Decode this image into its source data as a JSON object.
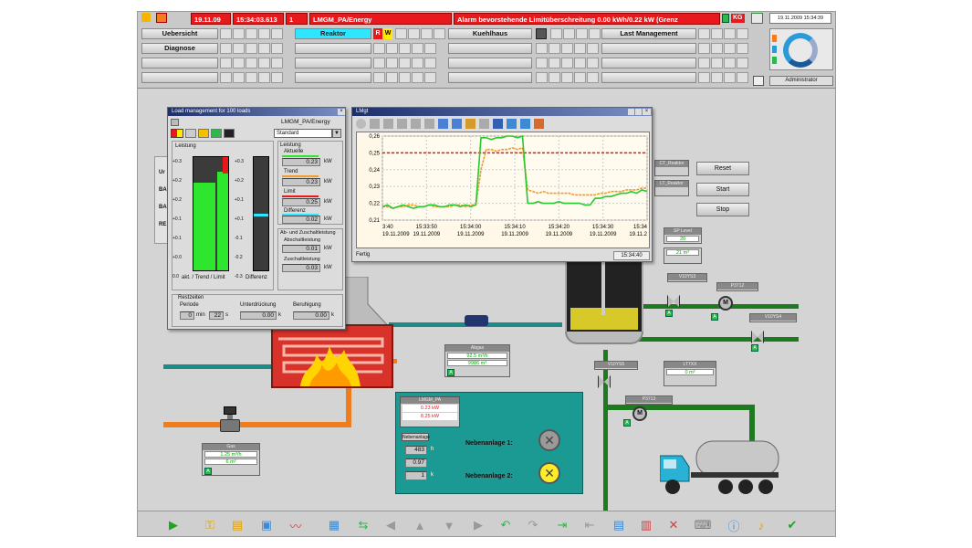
{
  "header": {
    "date": "19.11.09",
    "time": "15:34:03.613",
    "alarm_count": "1",
    "alarm_source": "LMGM_PA/Energy",
    "alarm_text": "Alarm bevorstehende Limitüberschreitung 0.00 kWh/0.22 kW (Grenz",
    "kg_label": "KG",
    "clock": "19.11.2009 15:34:39",
    "user": "Administrator"
  },
  "nav": {
    "uebersicht": "Uebersicht",
    "diagnose": "Diagnose",
    "reaktor": "Reaktor",
    "kuehlhaus": "Kuehlhaus",
    "last_management": "Last Management",
    "reaktor_r": "R",
    "reaktor_w": "W"
  },
  "faceplate": {
    "title": "Load management for 100 loads",
    "tag": "LMGM_PA/Energy",
    "mode": "Standard",
    "leistung": "Leistung",
    "aktuelle_lbl": "Aktuelle",
    "aktuelle": "0.23",
    "trend_lbl": "Trend",
    "trend": "0.23",
    "limit_lbl": "Limit",
    "limit": "0.25",
    "differenz_lbl": "Differenz",
    "differenz": "0.02",
    "unit": "kW",
    "ab_zuschalt": "Ab- und Zuschaltleistung",
    "abschaltleistung_lbl": "Abschaltleistung",
    "abschaltleistung": "0.01",
    "zuschaltleistung_lbl": "Zuschaltleistung",
    "zuschaltleistung": "0.03",
    "axis_left": [
      "+0.3",
      "+0.2",
      "+0.2",
      "+0.1",
      "+0.1",
      "+0.0",
      "0.0"
    ],
    "axis_right": [
      "+0.3",
      "+0.2",
      "+0.1",
      "+0.1",
      "-0.1",
      "-0.2",
      "-0.3"
    ],
    "bar_label_left": "akt. / Trend / Limit",
    "bar_label_right": "Differenz",
    "restzeiten": "Restzeiten",
    "periode_lbl": "Periode",
    "periode_min": "0",
    "min_unit": "min",
    "periode_s": "22",
    "s_unit": "s",
    "unterdrueckung_lbl": "Unterdrückung",
    "unterdrueckung": "0.00",
    "beruhigung_lbl": "Beruhigung",
    "beruhigung": "0.00",
    "k_unit": "k"
  },
  "trend": {
    "title": "LMgt",
    "status": "Fertig",
    "time": "15:34:40"
  },
  "chart_data": {
    "type": "line",
    "ylim": [
      0.21,
      0.26
    ],
    "yticks": [
      "0,26",
      "0,25",
      "0,24",
      "0,23",
      "0,22",
      "0,21"
    ],
    "x_labels": [
      [
        "3:40",
        "19.11.2009"
      ],
      [
        "15:33:50",
        "19.11.2009"
      ],
      [
        "15:34:00",
        "19.11.2009"
      ],
      [
        "15:34:10",
        "19.11.2009"
      ],
      [
        "15:34:20",
        "19.11.2009"
      ],
      [
        "15:34:30",
        "19.11.2009"
      ],
      [
        "15:34",
        "19.11.2"
      ]
    ],
    "limit": 0.25,
    "series": [
      {
        "color": "#27c92e",
        "values": [
          0.218,
          0.219,
          0.217,
          0.218,
          0.219,
          0.218,
          0.217,
          0.218,
          0.218,
          0.219,
          0.219,
          0.218,
          0.218,
          0.219,
          0.219,
          0.218,
          0.219,
          0.218,
          0.219,
          0.259,
          0.259,
          0.258,
          0.259,
          0.259,
          0.26,
          0.26,
          0.259,
          0.26,
          0.22,
          0.22,
          0.221,
          0.22,
          0.22,
          0.22,
          0.221,
          0.22,
          0.22,
          0.22,
          0.22,
          0.219,
          0.219,
          0.223,
          0.223,
          0.224,
          0.224,
          0.225,
          0.226,
          0.226,
          0.227,
          0.226,
          0.228,
          0.227
        ]
      },
      {
        "color": "#f39a2e",
        "values": [
          0.218,
          0.218,
          0.217,
          0.218,
          0.218,
          0.219,
          0.219,
          0.218,
          0.218,
          0.219,
          0.218,
          0.218,
          0.218,
          0.218,
          0.219,
          0.219,
          0.218,
          0.219,
          0.219,
          0.24,
          0.252,
          0.252,
          0.251,
          0.252,
          0.252,
          0.253,
          0.252,
          0.253,
          0.228,
          0.227,
          0.226,
          0.227,
          0.226,
          0.226,
          0.226,
          0.226,
          0.226,
          0.225,
          0.225,
          0.225,
          0.225,
          0.225,
          0.226,
          0.226,
          0.227,
          0.227,
          0.227,
          0.228,
          0.228,
          0.228,
          0.229,
          0.229
        ]
      }
    ]
  },
  "plant": {
    "gas_title": "Gas",
    "gas_flow": "1.25 m³/h",
    "gas_total": "6 m³",
    "ab_title": "Abgas",
    "ab_flow": "92.5 m³/h",
    "ab_total": "9986 m³",
    "buttons": {
      "reset": "Reset",
      "start": "Start",
      "stop": "Stop"
    },
    "ct_reaktor": "CT_Reaktor",
    "lt_reaktor": "LT_Reaktor",
    "sp_level": "SP Level",
    "sp_level_val": "20",
    "lt_val": "21 m³",
    "wv1": "V10YS3",
    "pt_pump": "P3712",
    "wv2": "V10YS4",
    "wv3": "V10YS5",
    "lt_out": "LT7XX",
    "lt_out_val": "0 m³",
    "pump2": "P3713"
  },
  "side": {
    "left_labels": [
      "Ur",
      "BA",
      "BA",
      "RE"
    ]
  },
  "panel": {
    "title": "LMGM_PA",
    "v1": "0.23 kW",
    "v2": "8.25 kW",
    "sub": "Nebenanlage",
    "n1": "483",
    "n1_unit": "h",
    "n2": "0.97",
    "n3": "1",
    "n3_unit": "k",
    "neben1": "Nebenanlage 1:",
    "neben2": "Nebenanlage 2:"
  }
}
